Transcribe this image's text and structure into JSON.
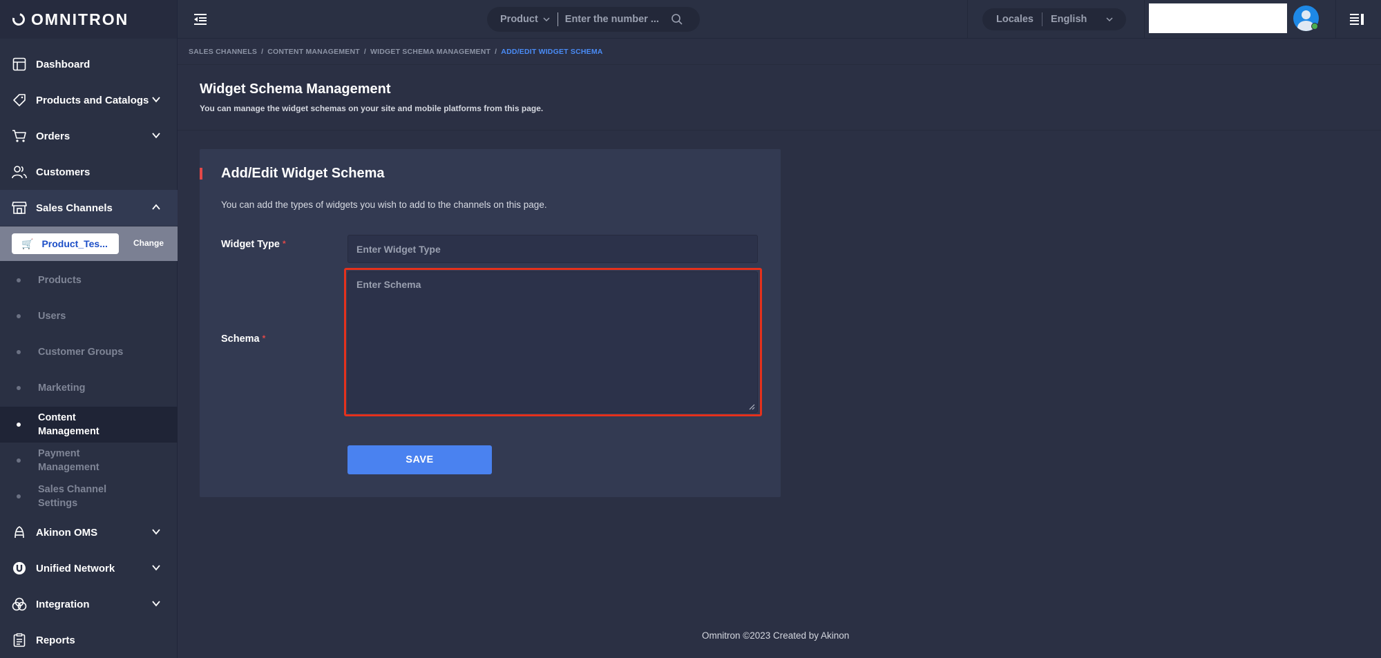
{
  "brand": {
    "logo_text": "OMNITRON"
  },
  "sidebar": {
    "items": [
      {
        "label": "Dashboard",
        "icon": "dashboard-icon"
      },
      {
        "label": "Products and Catalogs",
        "icon": "tag-icon"
      },
      {
        "label": "Orders",
        "icon": "cart-icon"
      },
      {
        "label": "Customers",
        "icon": "users-icon"
      },
      {
        "label": "Sales Channels",
        "icon": "store-icon"
      },
      {
        "label": "Akinon OMS",
        "icon": "oms-icon"
      },
      {
        "label": "Unified Network",
        "icon": "network-icon"
      },
      {
        "label": "Integration",
        "icon": "integration-icon"
      },
      {
        "label": "Reports",
        "icon": "reports-icon"
      }
    ],
    "channel": {
      "name": "Product_Tes...",
      "change_label": "Change"
    },
    "sub_items": [
      {
        "label": "Products"
      },
      {
        "label": "Users"
      },
      {
        "label": "Customer Groups"
      },
      {
        "label": "Marketing"
      },
      {
        "label": "Content Management"
      },
      {
        "label": "Payment Management"
      },
      {
        "label": "Sales Channel Settings"
      }
    ]
  },
  "topbar": {
    "search_type": "Product",
    "search_placeholder": "Enter the number ...",
    "locales_label": "Locales",
    "language": "English"
  },
  "breadcrumb": [
    "SALES CHANNELS",
    "CONTENT MANAGEMENT",
    "WIDGET SCHEMA MANAGEMENT",
    "ADD/EDIT WIDGET SCHEMA"
  ],
  "page": {
    "title": "Widget Schema Management",
    "subtitle": "You can manage the widget schemas on your site and mobile platforms from this page."
  },
  "form": {
    "title": "Add/Edit Widget Schema",
    "description": "You can add the types of widgets you wish to add to the channels on this page.",
    "widget_type_label": "Widget Type",
    "widget_type_placeholder": "Enter Widget Type",
    "schema_label": "Schema",
    "schema_placeholder": "Enter Schema",
    "required_mark": "*",
    "save_label": "SAVE"
  },
  "footer": {
    "text": "Omnitron ©2023 Created by Akinon"
  },
  "colors": {
    "background": "#2b3044",
    "card": "#333a52",
    "accent_blue": "#4a82f0",
    "required_red": "#e24848",
    "highlight_red": "#e5311c"
  }
}
